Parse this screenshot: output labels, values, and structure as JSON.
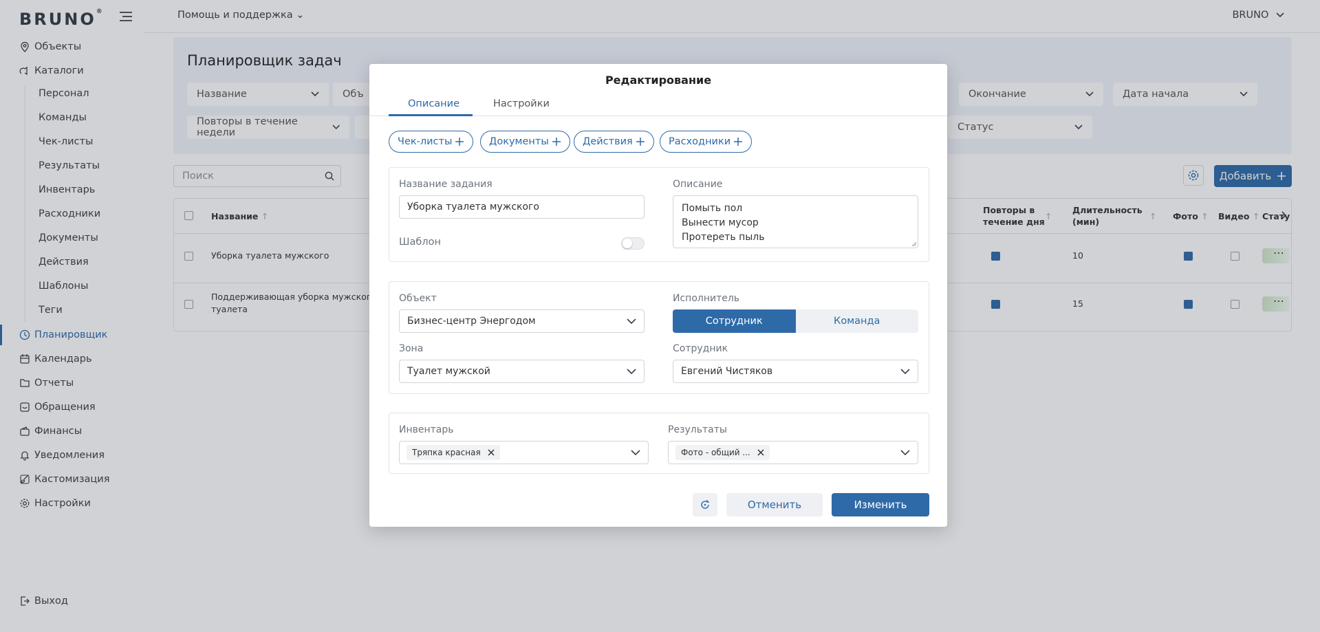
{
  "brand": {
    "name": "BRUNO",
    "mark": "®"
  },
  "sidebar": {
    "objects": "Объекты",
    "catalogs": "Каталоги",
    "catalog_items": [
      "Персонал",
      "Команды",
      "Чек-листы",
      "Результаты",
      "Инвентарь",
      "Расходники",
      "Документы",
      "Действия",
      "Шаблоны",
      "Теги"
    ],
    "planner": "Планировщик",
    "calendar": "Календарь",
    "reports": "Отчеты",
    "requests": "Обращения",
    "finance": "Финансы",
    "notifications": "Уведомления",
    "customization": "Кастомизация",
    "settings": "Настройки",
    "logout": "Выход"
  },
  "topbar": {
    "help": "Помощь и поддержка",
    "user": "BRUNO"
  },
  "page": {
    "title": "Планировщик задач",
    "filters": {
      "name": "Название",
      "object_partial": "Объ",
      "end": "Окончание",
      "start_date": "Дата начала",
      "weekly_repeats": "Повторы в течение недели",
      "status": "Статус"
    },
    "search_placeholder": "Поиск",
    "add_label": "Добавить"
  },
  "table": {
    "headers": {
      "name": "Название",
      "daily_repeats_1": "Повторы в",
      "daily_repeats_2": "течение дня",
      "duration_1": "Длительность",
      "duration_2": "(мин)",
      "photo": "Фото",
      "video": "Видео",
      "status": "Стату"
    },
    "rows": [
      {
        "name_1": "Уборка туалета мужского",
        "name_2": "",
        "duration": "10",
        "daily_repeats": true,
        "photo": true,
        "video": false
      },
      {
        "name_1": "Поддерживающая уборка мужского",
        "name_2": "туалета",
        "duration": "15",
        "daily_repeats": true,
        "photo": true,
        "video": false
      }
    ]
  },
  "modal": {
    "title": "Редактирование",
    "tabs": [
      "Описание",
      "Настройки"
    ],
    "chips": [
      "Чек-листы",
      "Документы",
      "Действия",
      "Расходники"
    ],
    "task_name_label": "Название задания",
    "task_name_value": "Уборка туалета мужского",
    "template_label": "Шаблон",
    "template_on": false,
    "description_label": "Описание",
    "description_lines": [
      "Помыть пол",
      "Вынести мусор",
      "Протереть пыль"
    ],
    "object_label": "Объект",
    "object_value": "Бизнес-центр Энергодом",
    "zone_label": "Зона",
    "zone_value": "Туалет мужской",
    "executor_label": "Исполнитель",
    "executor_options": [
      "Сотрудник",
      "Команда"
    ],
    "executor_selected": "Сотрудник",
    "employee_label": "Сотрудник",
    "employee_value": "Евгений Чистяков",
    "inventory_label": "Инвентарь",
    "inventory_tag": "Тряпка красная",
    "results_label": "Результаты",
    "results_tag": "Фото - общий ...",
    "cancel_label": "Отменить",
    "submit_label": "Изменить"
  },
  "colors": {
    "accent": "#2f6aa8",
    "overlay": "rgba(40,50,65,0.22)"
  }
}
